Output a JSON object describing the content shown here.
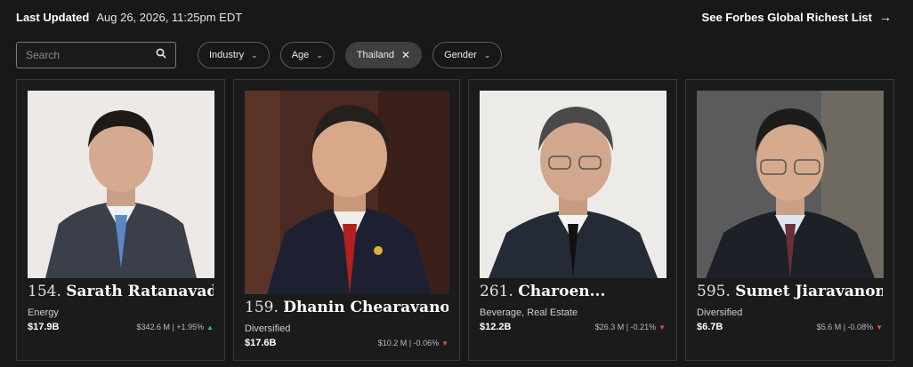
{
  "header": {
    "updated_label": "Last Updated",
    "updated_value": "Aug 26, 2026, 11:25pm EDT",
    "richest_link": "See Forbes Global Richest List",
    "arrow_icon": "arrow-right-icon"
  },
  "filters": {
    "search_placeholder": "Search",
    "search_icon": "search-icon",
    "pills": [
      {
        "label": "Industry",
        "icon": "chevron-down-icon",
        "active": false
      },
      {
        "label": "Age",
        "icon": "chevron-down-icon",
        "active": false
      },
      {
        "label": "Thailand",
        "icon": "close-icon",
        "active": true
      },
      {
        "label": "Gender",
        "icon": "chevron-down-icon",
        "active": false
      }
    ]
  },
  "cards": [
    {
      "rank": "154.",
      "name": "Sarath Ratanavadi",
      "industry": "Energy",
      "net_worth": "$17.9B",
      "change": "$342.6 M | +1.95%",
      "trend": "up"
    },
    {
      "rank": "159.",
      "name": "Dhanin Chearavanont",
      "industry": "Diversified",
      "net_worth": "$17.6B",
      "change": "$10.2 M | -0.06%",
      "trend": "down"
    },
    {
      "rank": "261.",
      "name": "Charoen...",
      "industry": "Beverage, Real Estate",
      "net_worth": "$12.2B",
      "change": "$26.3 M | -0.21%",
      "trend": "down"
    },
    {
      "rank": "595.",
      "name": "Sumet Jiaravanon",
      "industry": "Diversified",
      "net_worth": "$6.7B",
      "change": "$5.6 M | -0.08%",
      "trend": "down"
    }
  ],
  "colors": {
    "background": "#181818",
    "up": "#3fbf6f",
    "down": "#e0553b"
  }
}
